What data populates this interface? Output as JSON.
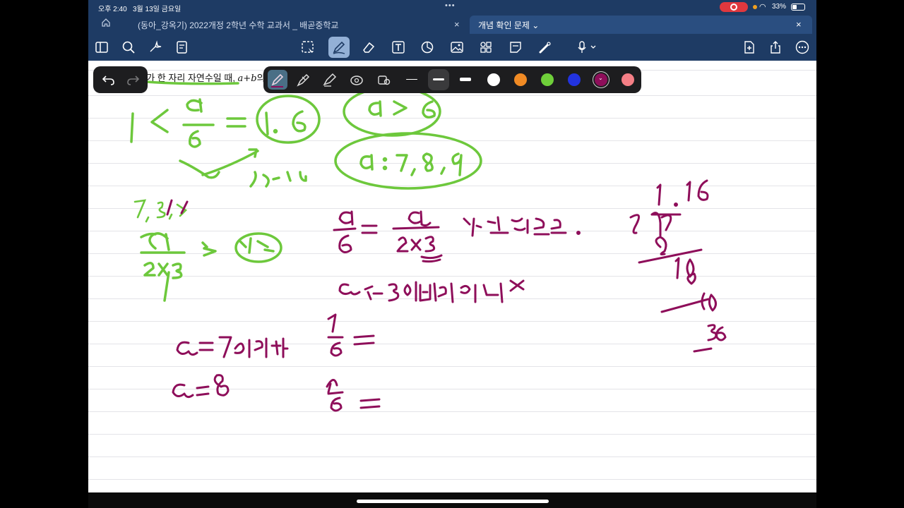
{
  "status": {
    "time": "오후 2:40",
    "date": "3월 13일 금요일",
    "battery": "33%"
  },
  "tabs": [
    {
      "label": "(동아_강옥기) 2022개정 2학년 수학 교과서 _ 배곧중학교",
      "active": false
    },
    {
      "label": "개념 확인 문제 ⌄",
      "active": true
    }
  ],
  "toolbar": {
    "left": [
      "sidebar-icon",
      "search-icon",
      "sparkle-icon",
      "notes-icon"
    ],
    "center": [
      "lasso-icon",
      "pen-icon",
      "eraser-icon",
      "text-icon",
      "shapes-icon",
      "image-icon",
      "elements-icon",
      "sticky-note-icon",
      "laser-icon",
      "mic-icon"
    ],
    "right": [
      "add-page-icon",
      "share-icon",
      "more-icon"
    ]
  },
  "question": {
    "text_before": "6가 한 자리 자연수일 때, ",
    "math": "a+b",
    "text_after": "의"
  },
  "pen_palette": {
    "colors": [
      "#ffffff",
      "#f08a24",
      "#6fcf3a",
      "#2233e0",
      "#8e0e5a",
      "#f57f86"
    ],
    "selected_color": "#8e0e5a"
  },
  "colors": {
    "green_ink": "#6dc83c",
    "purple_ink": "#8e0e5a",
    "chrome": "#1e3b64"
  }
}
